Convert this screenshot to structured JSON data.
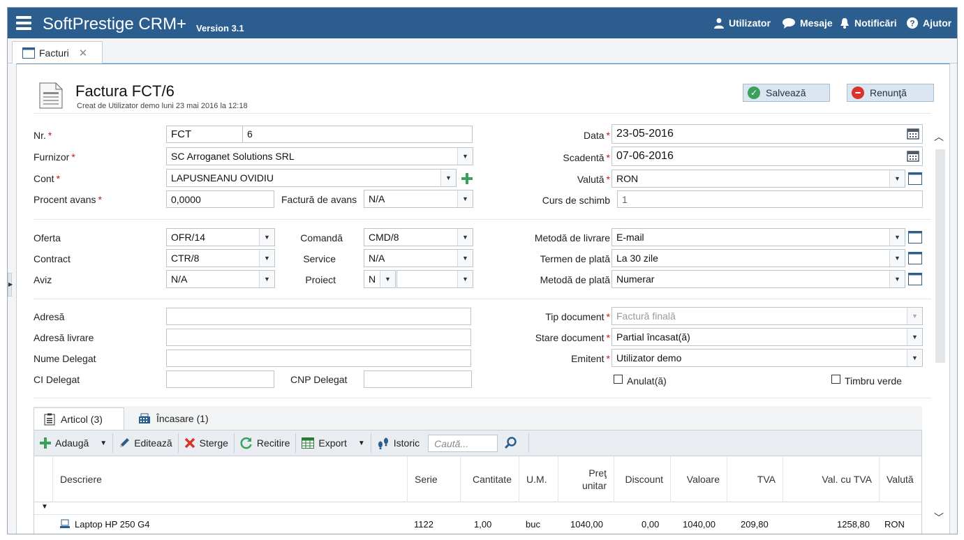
{
  "app": {
    "title": "SoftPrestige CRM+",
    "version": "Version 3.1"
  },
  "nav": {
    "user": "Utilizator",
    "messages": "Mesaje",
    "notifications": "Notificări",
    "help": "Ajutor"
  },
  "tab": {
    "label": "Facturi"
  },
  "document": {
    "title": "Factura FCT/6",
    "subtitle": "Creat de Utilizator demo luni 23 mai 2016 la 12:18",
    "save": "Salvează",
    "cancel": "Renunţă"
  },
  "form": {
    "nr_label": "Nr.",
    "nr_prefix": "FCT",
    "nr_value": "6",
    "furnizor_label": "Furnizor",
    "furnizor_value": "SC Arroganet Solutions SRL",
    "cont_label": "Cont",
    "cont_value": "LAPUSNEANU OVIDIU",
    "procent_label": "Procent avans",
    "procent_value": "0,0000",
    "factura_avans_label": "Factură de avans",
    "factura_avans_value": "N/A",
    "data_label": "Data",
    "data_value": "23-05-2016",
    "scadenta_label": "Scadentă",
    "scadenta_value": "07-06-2016",
    "valuta_label": "Valută",
    "valuta_value": "RON",
    "curs_label": "Curs de schimb",
    "curs_value": "1",
    "oferta_label": "Oferta",
    "oferta_value": "OFR/14",
    "comanda_label": "Comandă",
    "comanda_value": "CMD/8",
    "metoda_livrare_label": "Metodă de livrare",
    "metoda_livrare_value": "E-mail",
    "contract_label": "Contract",
    "contract_value": "CTR/8",
    "service_label": "Service",
    "service_value": "N/A",
    "termen_plata_label": "Termen de plată",
    "termen_plata_value": "La 30 zile",
    "aviz_label": "Aviz",
    "aviz_value": "N/A",
    "proiect_label": "Proiect",
    "proiect_value": "N",
    "metoda_plata_label": "Metodă de plată",
    "metoda_plata_value": "Numerar",
    "adresa_label": "Adresă",
    "adresa_livrare_label": "Adresă livrare",
    "nume_delegat_label": "Nume Delegat",
    "ci_delegat_label": "CI Delegat",
    "cnp_delegat_label": "CNP Delegat",
    "tip_doc_label": "Tip document",
    "tip_doc_value": "Factură finală",
    "stare_doc_label": "Stare document",
    "stare_doc_value": "Partial încasat(ă)",
    "emitent_label": "Emitent",
    "emitent_value": "Utilizator demo",
    "anulat_label": "Anulat(ă)",
    "timbru_label": "Timbru verde"
  },
  "grid_tabs": {
    "articol": "Articol (3)",
    "incasare": "Încasare (1)"
  },
  "toolbar": {
    "add": "Adaugă",
    "edit": "Editează",
    "delete": "Sterge",
    "reload": "Recitire",
    "export": "Export",
    "history": "Istoric",
    "search_placeholder": "Caută..."
  },
  "columns": {
    "descriere": "Descriere",
    "serie": "Serie",
    "cantitate": "Cantitate",
    "um": "U.M.",
    "pret": "Preţ unitar",
    "discount": "Discount",
    "valoare": "Valoare",
    "tva": "TVA",
    "val_tva": "Val. cu TVA",
    "valuta": "Valută"
  },
  "rows": [
    {
      "descriere": "Laptop HP 250 G4",
      "serie": "1122",
      "cantitate": "1,00",
      "um": "buc",
      "pret": "1040,00",
      "discount": "0,00",
      "valoare": "1040,00",
      "tva": "209,80",
      "val_tva": "1258,80",
      "valuta": "RON"
    }
  ],
  "colors": {
    "topbar": "#2b5d8e",
    "required": "#d01010",
    "save_icon": "#3aa05a",
    "cancel_icon": "#d9342b"
  }
}
